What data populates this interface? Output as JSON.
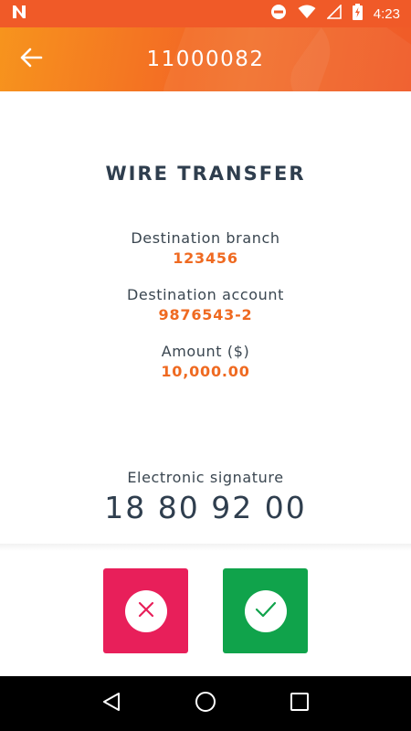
{
  "status_bar": {
    "time": "4:23"
  },
  "header": {
    "title": "11000082"
  },
  "transfer": {
    "heading": "WIRE TRANSFER",
    "fields": [
      {
        "label": "Destination branch",
        "value": "123456"
      },
      {
        "label": "Destination account",
        "value": "9876543-2"
      },
      {
        "label": "Amount ($)",
        "value": "10,000.00"
      }
    ],
    "signature_label": "Electronic signature",
    "signature_value": "18 80 92 00"
  },
  "colors": {
    "header_orange": "#f05a28",
    "value_orange": "#ef6a21",
    "cancel_red": "#e81f5a",
    "confirm_green": "#10a34b",
    "text_dark": "#2f3e4e"
  },
  "icons": {
    "back": "arrow-left-icon",
    "cancel": "close-icon",
    "confirm": "check-icon",
    "nav_back": "triangle-back-icon",
    "nav_home": "circle-home-icon",
    "nav_recents": "square-recents-icon"
  }
}
